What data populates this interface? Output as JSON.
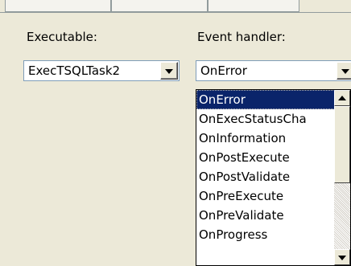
{
  "executable": {
    "label": "Executable:",
    "selected": "ExecTSQLTask2"
  },
  "event_handler": {
    "label": "Event handler:",
    "selected": "OnError",
    "options": [
      "OnError",
      "OnExecStatusCha",
      "OnInformation",
      "OnPostExecute",
      "OnPostValidate",
      "OnPreExecute",
      "OnPreValidate",
      "OnProgress"
    ],
    "highlighted_index": 0
  },
  "icons": {
    "combo_arrow": "chevron-down-icon",
    "scroll_up": "arrow-up-icon",
    "scroll_down": "arrow-down-icon"
  },
  "colors": {
    "selection": "#0a246a",
    "window": "#ece9d8"
  }
}
